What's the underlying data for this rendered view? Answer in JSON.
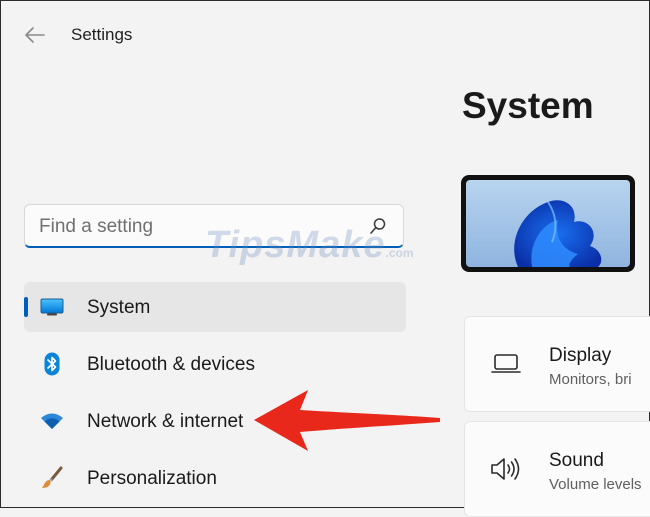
{
  "app": {
    "title": "Settings"
  },
  "page": {
    "title": "System"
  },
  "search": {
    "placeholder": "Find a setting"
  },
  "watermark": {
    "text": "TipsMake",
    "suffix": ".com"
  },
  "nav": {
    "items": [
      {
        "label": "System",
        "icon": "monitor-icon",
        "active": true
      },
      {
        "label": "Bluetooth & devices",
        "icon": "bluetooth-icon",
        "active": false
      },
      {
        "label": "Network & internet",
        "icon": "wifi-icon",
        "active": false
      },
      {
        "label": "Personalization",
        "icon": "paintbrush-icon",
        "active": false
      }
    ]
  },
  "cards": [
    {
      "title": "Display",
      "subtitle": "Monitors, bri",
      "icon": "laptop-icon"
    },
    {
      "title": "Sound",
      "subtitle": "Volume levels",
      "icon": "speaker-icon"
    }
  ],
  "colors": {
    "accent": "#005fb8",
    "annotation_arrow": "#e8281a"
  }
}
